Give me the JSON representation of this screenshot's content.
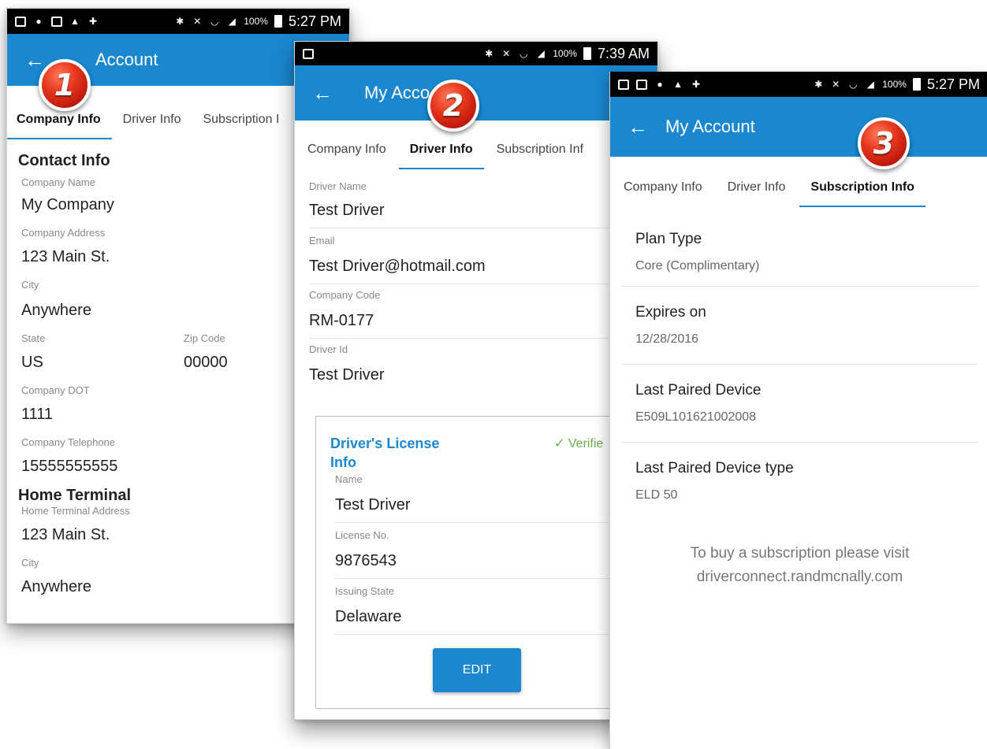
{
  "screen1": {
    "status": {
      "time": "5:27 PM",
      "battery": "100%"
    },
    "appbar": {
      "back": "←",
      "title": "Account"
    },
    "badge": "1",
    "tabs": [
      "Company Info",
      "Driver Info",
      "Subscription I"
    ],
    "contact_heading": "Contact Info",
    "fields": [
      {
        "label": "Company Name",
        "value": "My Company"
      },
      {
        "label": "Company Address",
        "value": "123 Main St."
      },
      {
        "label": "City",
        "value": "Anywhere"
      }
    ],
    "state": {
      "label": "State",
      "value": "US"
    },
    "zip": {
      "label": "Zip Code",
      "value": "00000"
    },
    "fields2": [
      {
        "label": "Company DOT",
        "value": "1111"
      },
      {
        "label": "Company Telephone",
        "value": "15555555555"
      }
    ],
    "home_heading": "Home Terminal",
    "home_fields": [
      {
        "label": "Home Terminal Address",
        "value": "123 Main St."
      },
      {
        "label": "City",
        "value": "Anywhere"
      }
    ]
  },
  "screen2": {
    "status": {
      "time": "7:39 AM",
      "battery": "100%"
    },
    "appbar": {
      "back": "←",
      "title": "My Acco"
    },
    "badge": "2",
    "tabs": [
      "Company Info",
      "Driver Info",
      "Subscription Inf"
    ],
    "fields": [
      {
        "label": "Driver Name",
        "value": "Test Driver"
      },
      {
        "label": "Email",
        "value": "Test Driver@hotmail.com"
      },
      {
        "label": "Company Code",
        "value": "RM-0177"
      },
      {
        "label": "Driver Id",
        "value": "Test Driver"
      }
    ],
    "license": {
      "title_line1": "Driver's License",
      "title_line2": "Info",
      "verified": "✓ Verifie",
      "fields": [
        {
          "label": "Name",
          "value": "Test Driver"
        },
        {
          "label": "License No.",
          "value": "9876543"
        },
        {
          "label": "Issuing State",
          "value": "Delaware"
        }
      ],
      "edit": "EDIT"
    }
  },
  "screen3": {
    "status": {
      "time": "5:27 PM",
      "battery": "100%"
    },
    "appbar": {
      "back": "←",
      "title": "My Account"
    },
    "badge": "3",
    "tabs": [
      "Company Info",
      "Driver Info",
      "Subscription Info"
    ],
    "items": [
      {
        "label": "Plan Type",
        "value": "Core (Complimentary)"
      },
      {
        "label": "Expires on",
        "value": "12/28/2016"
      },
      {
        "label": "Last Paired Device",
        "value": "E509L101621002008"
      },
      {
        "label": "Last Paired Device type",
        "value": "ELD 50"
      }
    ],
    "note_line1": "To buy a subscription please visit",
    "note_line2": "driverconnect.randmcnally.com"
  },
  "colors": {
    "accent": "#1a87cf",
    "badge": "#e8381e",
    "verified": "#6ab04c"
  }
}
